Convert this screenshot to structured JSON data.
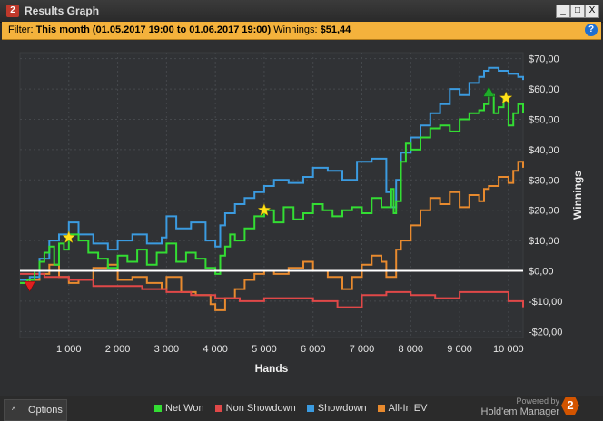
{
  "window": {
    "app_icon": "2",
    "title": "Results Graph",
    "minimize": "_",
    "maximize": "□",
    "close": "X"
  },
  "filter": {
    "label": "Filter:",
    "value": "This month (01.05.2017 19:00 to 01.06.2017 19:00)",
    "winnings_label": "Winnings:",
    "winnings_value": "$51,44",
    "help": "?"
  },
  "chart_data": {
    "type": "line",
    "xlabel": "Hands",
    "ylabel": "Winnings",
    "xlim": [
      0,
      10300
    ],
    "ylim": [
      -22,
      72
    ],
    "x_ticks": [
      1000,
      2000,
      3000,
      4000,
      5000,
      6000,
      7000,
      8000,
      9000,
      10000
    ],
    "x_tick_labels": [
      "1 000",
      "2 000",
      "3 000",
      "4 000",
      "5 000",
      "6 000",
      "7 000",
      "8 000",
      "9 000",
      "10 000"
    ],
    "y_ticks": [
      70,
      60,
      50,
      40,
      30,
      20,
      10,
      0,
      -10,
      -20
    ],
    "y_tick_labels": [
      "$70,00",
      "$60,00",
      "$50,00",
      "$40,00",
      "$30,00",
      "$20,00",
      "$10,00",
      "$0,00",
      "-$10,00",
      "-$20,00"
    ],
    "grid": true,
    "legend_position": "bottom",
    "series": [
      {
        "name": "Net Won",
        "color": "#33dd33",
        "x": [
          0,
          150,
          300,
          400,
          500,
          600,
          700,
          800,
          900,
          1000,
          1200,
          1400,
          1600,
          1800,
          2000,
          2200,
          2400,
          2600,
          2800,
          3000,
          3200,
          3400,
          3600,
          3800,
          4000,
          4100,
          4200,
          4300,
          4400,
          4600,
          4800,
          5000,
          5200,
          5400,
          5600,
          5800,
          6000,
          6200,
          6400,
          6600,
          6800,
          7000,
          7200,
          7400,
          7600,
          7650,
          7700,
          7800,
          7900,
          8000,
          8200,
          8400,
          8600,
          8800,
          9000,
          9200,
          9400,
          9500,
          9600,
          9700,
          9800,
          9900,
          10000,
          10100,
          10200,
          10300
        ],
        "y": [
          -4,
          -3,
          0,
          3,
          6,
          8,
          2,
          9,
          7,
          12,
          10,
          6,
          4,
          1,
          5,
          3,
          7,
          2,
          6,
          9,
          3,
          6,
          4,
          1,
          -1,
          5,
          8,
          12,
          10,
          14,
          18,
          20,
          16,
          21,
          17,
          19,
          22,
          20,
          18,
          20,
          21,
          19,
          24,
          21,
          27,
          19,
          23,
          36,
          42,
          40,
          44,
          47,
          48,
          46,
          50,
          52,
          53,
          55,
          58,
          52,
          54,
          57,
          48,
          52,
          55,
          52
        ]
      },
      {
        "name": "Non Showdown",
        "color": "#e04848",
        "x": [
          0,
          500,
          1000,
          1500,
          2000,
          2500,
          3000,
          3500,
          4000,
          4500,
          5000,
          5500,
          6000,
          6500,
          7000,
          7500,
          8000,
          8500,
          9000,
          9500,
          10000,
          10300
        ],
        "y": [
          -1,
          -2,
          -3,
          -5,
          -5,
          -6,
          -7,
          -8,
          -9,
          -10,
          -9,
          -9,
          -10,
          -12,
          -8,
          -7,
          -8,
          -9,
          -7,
          -7,
          -10,
          -12
        ]
      },
      {
        "name": "Showdown",
        "color": "#3b9be0",
        "x": [
          0,
          200,
          400,
          600,
          800,
          1000,
          1200,
          1500,
          1800,
          2000,
          2300,
          2600,
          2900,
          3000,
          3200,
          3500,
          3800,
          4000,
          4100,
          4200,
          4400,
          4600,
          4800,
          5000,
          5200,
          5500,
          5800,
          6000,
          6300,
          6600,
          6900,
          7200,
          7500,
          7600,
          7700,
          7800,
          8000,
          8200,
          8400,
          8600,
          8800,
          9000,
          9200,
          9400,
          9500,
          9600,
          9800,
          10000,
          10200,
          10300
        ],
        "y": [
          -3,
          -2,
          4,
          10,
          12,
          16,
          12,
          9,
          7,
          10,
          12,
          9,
          11,
          18,
          14,
          16,
          10,
          8,
          15,
          19,
          22,
          24,
          26,
          28,
          30,
          29,
          31,
          34,
          33,
          30,
          36,
          37,
          26,
          21,
          30,
          39,
          44,
          48,
          52,
          55,
          60,
          58,
          62,
          64,
          66,
          67,
          66,
          65,
          64,
          63
        ]
      },
      {
        "name": "All-In EV",
        "color": "#e88a2e",
        "x": [
          0,
          200,
          400,
          600,
          800,
          1000,
          1200,
          1500,
          1800,
          2000,
          2300,
          2600,
          2900,
          3000,
          3300,
          3600,
          3900,
          4000,
          4200,
          4400,
          4600,
          4800,
          5000,
          5200,
          5500,
          5800,
          6000,
          6300,
          6600,
          6800,
          7000,
          7200,
          7400,
          7500,
          7700,
          7800,
          8000,
          8200,
          8400,
          8600,
          8800,
          9000,
          9200,
          9400,
          9500,
          9600,
          9800,
          10000,
          10100,
          10200,
          10300
        ],
        "y": [
          -4,
          -3,
          -1,
          2,
          -2,
          -4,
          -3,
          1,
          2,
          -3,
          -2,
          -4,
          -6,
          -2,
          -7,
          -8,
          -11,
          -13,
          -9,
          -6,
          -3,
          -1,
          0,
          -1,
          1,
          3,
          0,
          -2,
          -6,
          -2,
          2,
          5,
          3,
          -2,
          7,
          10,
          15,
          20,
          24,
          22,
          26,
          21,
          25,
          23,
          27,
          28,
          31,
          29,
          33,
          36,
          34
        ]
      }
    ],
    "markers": [
      {
        "type": "star",
        "color": "#ffe11a",
        "x": 1000,
        "y": 11
      },
      {
        "type": "star",
        "color": "#ffe11a",
        "x": 5000,
        "y": 20
      },
      {
        "type": "star",
        "color": "#ffe11a",
        "x": 9950,
        "y": 57
      },
      {
        "type": "triangle-down",
        "color": "#e02020",
        "x": 200,
        "y": -5
      },
      {
        "type": "triangle-up",
        "color": "#1faa2a",
        "x": 9600,
        "y": 59
      }
    ],
    "zero_line_color": "#ffffff"
  },
  "bottom": {
    "options_caret": "^",
    "options_label": "Options",
    "powered_line1": "Powered by",
    "powered_line2": "Hold'em Manager",
    "logo": "2"
  }
}
